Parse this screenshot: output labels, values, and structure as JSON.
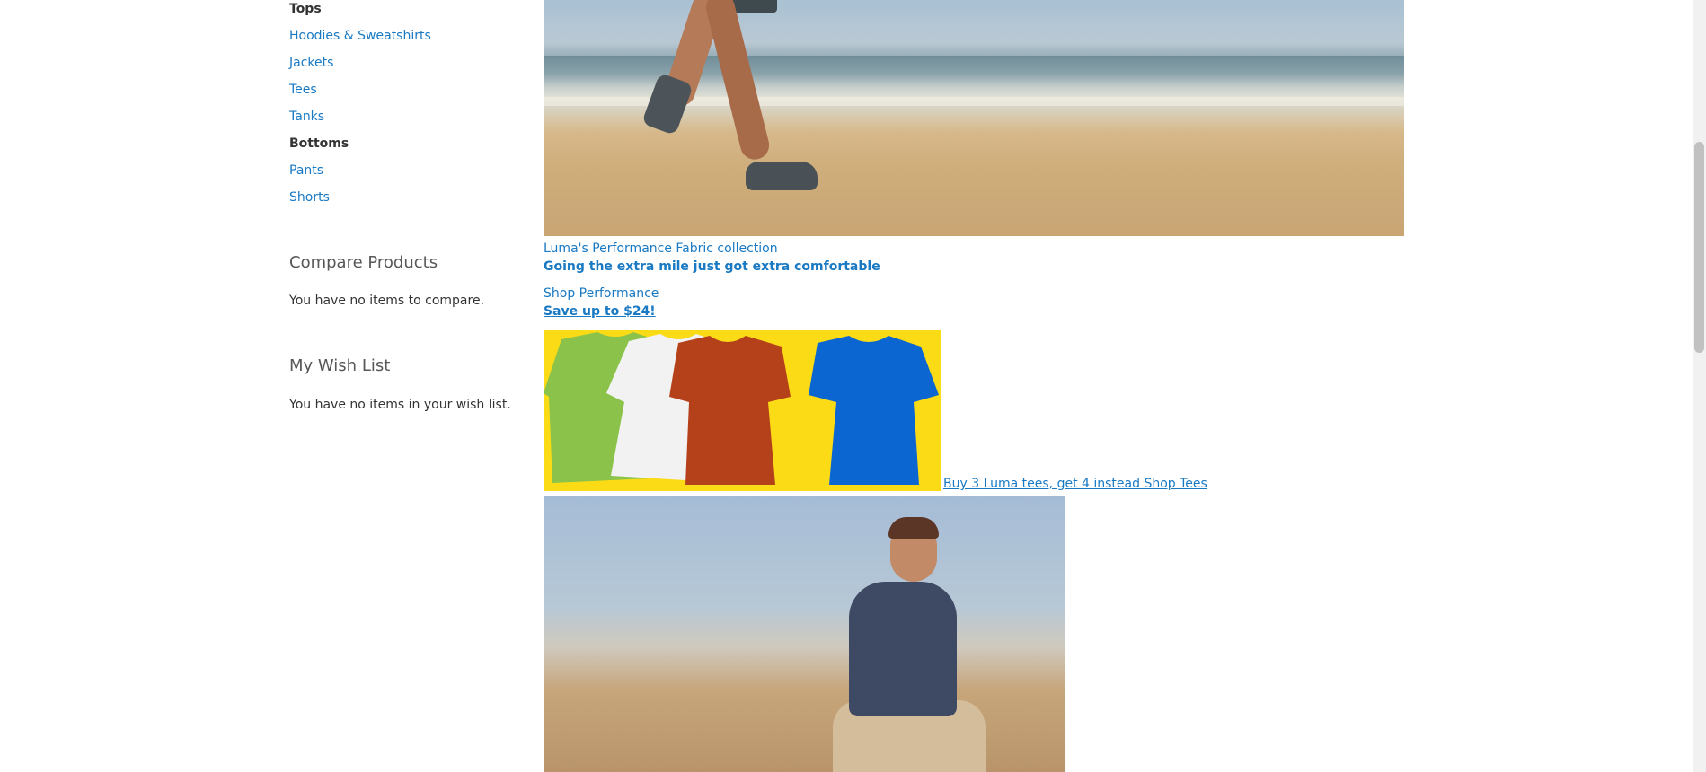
{
  "sidebar": {
    "groups": [
      {
        "title": "Tops",
        "items": [
          "Hoodies & Sweatshirts",
          "Jackets",
          "Tees",
          "Tanks"
        ]
      },
      {
        "title": "Bottoms",
        "items": [
          "Pants",
          "Shorts"
        ]
      }
    ],
    "compare": {
      "title": "Compare Products",
      "text": "You have no items to compare."
    },
    "wishlist": {
      "title": "My Wish List",
      "text": "You have no items in your wish list."
    }
  },
  "content": {
    "performance": {
      "title": "Luma's Performance Fabric collection",
      "subtitle": "Going the extra mile just got extra comfortable"
    },
    "shop_performance": {
      "title": "Shop Performance",
      "save": "Save up to $24!"
    },
    "tees_promo": {
      "link": "Buy 3 Luma tees, get 4 instead Shop Tees",
      "tee_colors": [
        "#8bc34a",
        "#f2f2f2",
        "#b5411b",
        "#0b66d1"
      ]
    }
  },
  "colors": {
    "link": "#1979c3",
    "text": "#333333",
    "promo_bg": "#fbdb16"
  }
}
